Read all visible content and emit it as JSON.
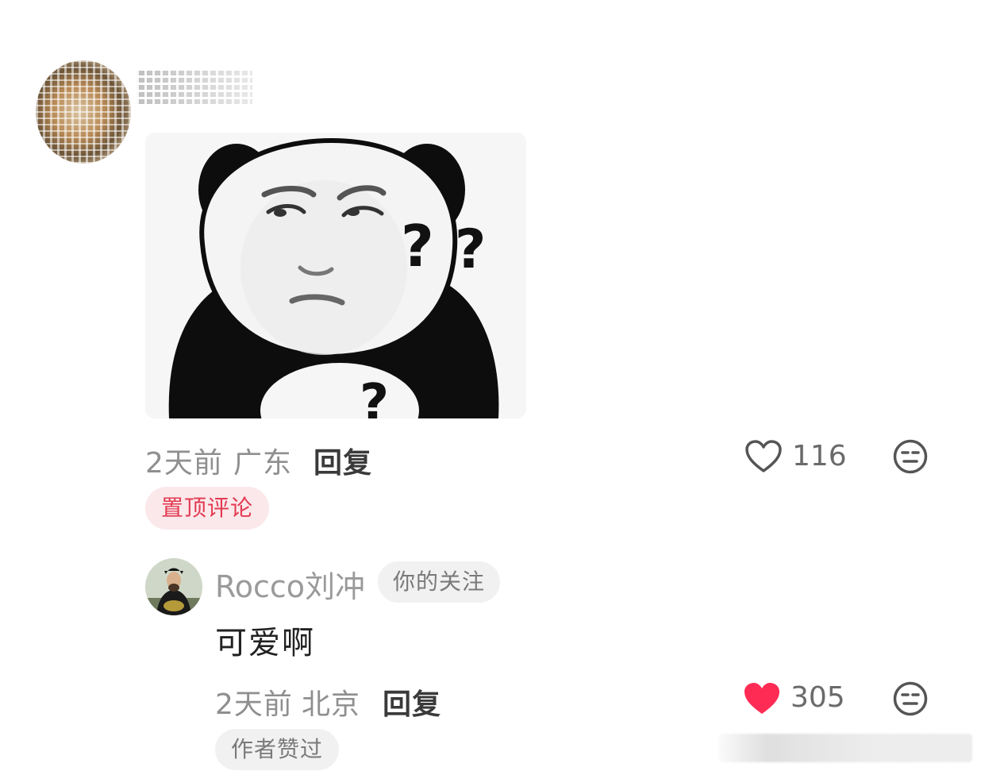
{
  "comment": {
    "time": "2天前",
    "location": "广东",
    "reply_label": "回复",
    "like_count": "116",
    "liked": false,
    "pinned_badge": "置顶评论",
    "image_icon": "panda-meme-sticker"
  },
  "reply": {
    "username": "Rocco刘冲",
    "follow_badge": "你的关注",
    "text": "可爱啊",
    "time": "2天前",
    "location": "北京",
    "reply_label": "回复",
    "like_count": "305",
    "liked": true,
    "author_badge": "作者赞过"
  },
  "icons": {
    "like": "heart-icon",
    "dislike": "meh-face-icon"
  },
  "colors": {
    "accent_red": "#fe2c55",
    "pinned_text": "#e23a52",
    "pinned_bg": "#fbe8ea",
    "meta_gray": "#8f8f8f"
  }
}
